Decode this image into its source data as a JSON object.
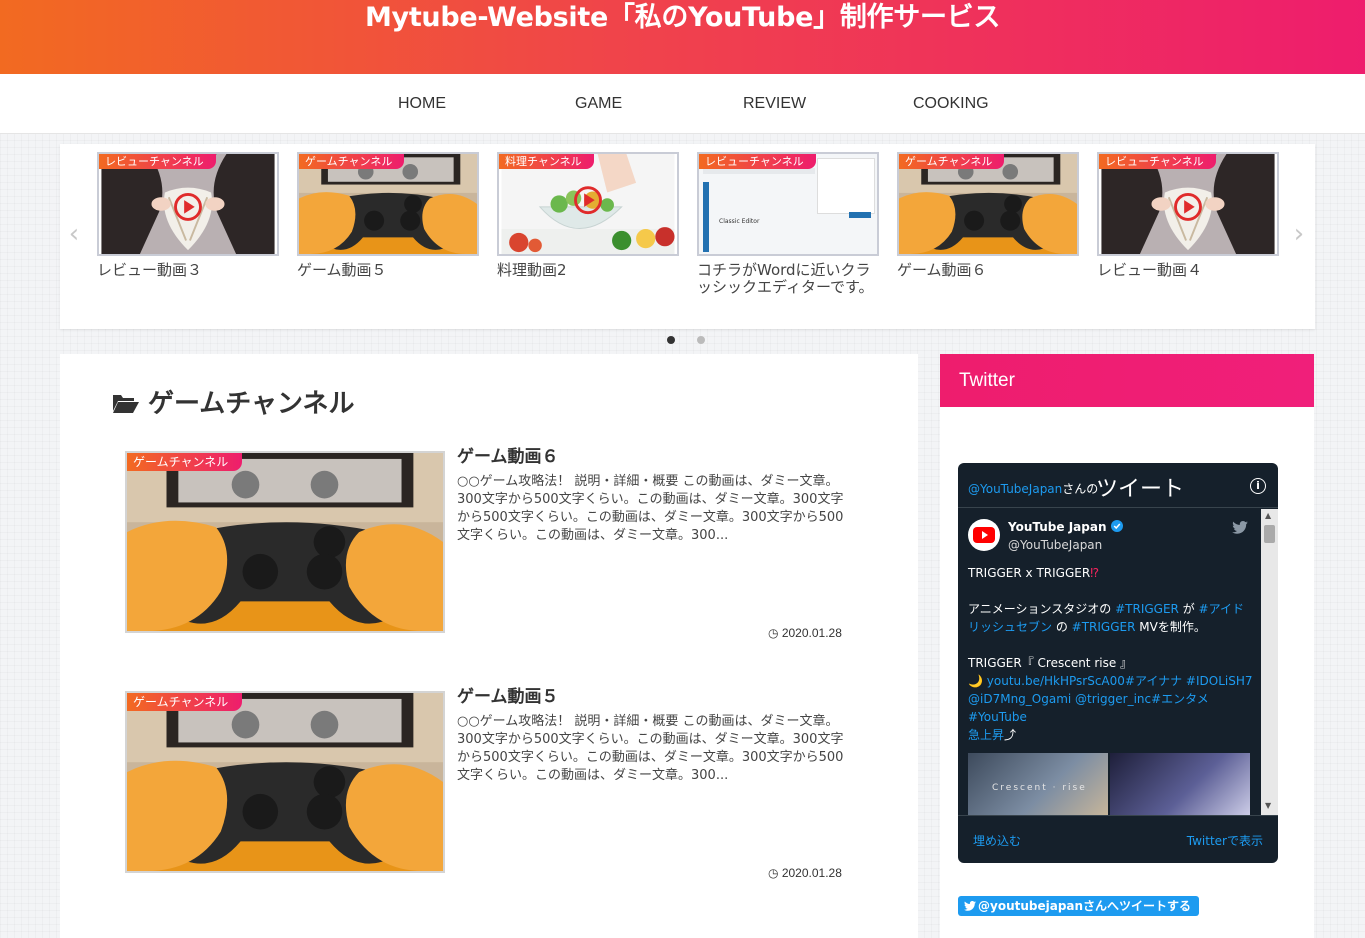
{
  "site": {
    "title": "Mytube-Website「私のYouTube」制作サービス"
  },
  "nav": [
    {
      "label": "HOME"
    },
    {
      "label": "GAME"
    },
    {
      "label": "REVIEW"
    },
    {
      "label": "COOKING"
    }
  ],
  "carousel": {
    "slides": [
      {
        "category": "レビューチャンネル",
        "title": "レビュー動画３",
        "thumb": "review"
      },
      {
        "category": "ゲームチャンネル",
        "title": "ゲーム動画５",
        "thumb": "game"
      },
      {
        "category": "料理チャンネル",
        "title": "料理動画2",
        "thumb": "cooking"
      },
      {
        "category": "レビューチャンネル",
        "title": "コチラがWordに近いクラッシックエディターです。",
        "thumb": "editor",
        "editor_caption": "Classic Editor"
      },
      {
        "category": "ゲームチャンネル",
        "title": "ゲーム動画６",
        "thumb": "game"
      },
      {
        "category": "レビューチャンネル",
        "title": "レビュー動画４",
        "thumb": "review"
      }
    ],
    "active_page": 1,
    "page_count": 2
  },
  "archive": {
    "title": "ゲームチャンネル",
    "posts": [
      {
        "category": "ゲームチャンネル",
        "title": "ゲーム動画６",
        "excerpt": "○○ゲーム攻略法！ 説明・詳細・概要 この動画は、ダミー文章。300文字から500文字くらい。この動画は、ダミー文章。300文字から500文字くらい。この動画は、ダミー文章。300文字から500文字くらい。この動画は、ダミー文章。300...",
        "date": "2020.01.28"
      },
      {
        "category": "ゲームチャンネル",
        "title": "ゲーム動画５",
        "excerpt": "○○ゲーム攻略法！ 説明・詳細・概要 この動画は、ダミー文章。300文字から500文字くらい。この動画は、ダミー文章。300文字から500文字くらい。この動画は、ダミー文章。300文字から500文字くらい。この動画は、ダミー文章。300...",
        "date": "2020.01.28"
      }
    ]
  },
  "sidebar": {
    "widget_title": "Twitter",
    "timeline": {
      "handle_link": "@YouTubeJapan",
      "handle_suffix": "さんの",
      "heading": "ツイート",
      "info": "i",
      "tweet": {
        "name": "YouTube Japan",
        "user": "@YouTubeJapan",
        "line1_text": "TRIGGER x TRIGGER",
        "line1_mark": "⁉",
        "line2_a": "アニメーションスタジオの ",
        "line2_tag1": "#TRIGGER",
        "line2_b": " が ",
        "line2_tag2": "#アイドリッシュセブン",
        "line2_c": " の ",
        "line2_tag3": "#TRIGGER",
        "line2_d": " MVを制作。",
        "line3": "TRIGGER『 Crescent rise 』",
        "line4_moon": "🌙",
        "line4_links": "youtu.be/HkHPsrScA00#アイナナ #IDOLiSH7 @iD7Mng_Ogami @trigger_inc#エンタメ #YouTube",
        "line5_a": "急上昇",
        "line5_b": "⤴",
        "image_caption": "Crescent · rise"
      },
      "embed_label": "埋め込む",
      "view_label": "Twitterで表示"
    },
    "tweet_button": "@youtubejapanさんへツイートする"
  },
  "colors": {
    "header_start": "#f26a21",
    "header_end": "#ee1d6d",
    "accent": "#ee1d6d",
    "twitter_blue": "#1d9bf0",
    "twitter_dark": "#15202b"
  }
}
